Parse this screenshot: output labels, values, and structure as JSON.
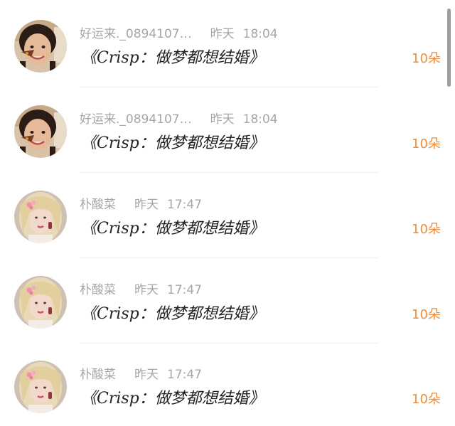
{
  "comments": [
    {
      "user": "好运来._0894107…",
      "date": "昨天",
      "time": "18:04",
      "title": "《Crisp：做梦都想结婚》",
      "count": "10朵",
      "avatar": "girl-avatar"
    },
    {
      "user": "好运来._0894107…",
      "date": "昨天",
      "time": "18:04",
      "title": "《Crisp：做梦都想结婚》",
      "count": "10朵",
      "avatar": "girl-avatar"
    },
    {
      "user": "朴酸菜",
      "date": "昨天",
      "time": "17:47",
      "title": "《Crisp：做梦都想结婚》",
      "count": "10朵",
      "avatar": "blonde-avatar"
    },
    {
      "user": "朴酸菜",
      "date": "昨天",
      "time": "17:47",
      "title": "《Crisp：做梦都想结婚》",
      "count": "10朵",
      "avatar": "blonde-avatar"
    },
    {
      "user": "朴酸菜",
      "date": "昨天",
      "time": "17:47",
      "title": "《Crisp：做梦都想结婚》",
      "count": "10朵",
      "avatar": "blonde-avatar"
    }
  ],
  "colors": {
    "meta": "#a6a6a6",
    "title": "#222222",
    "count": "#f08c3a",
    "scrollbar": "#9e9e9e"
  }
}
